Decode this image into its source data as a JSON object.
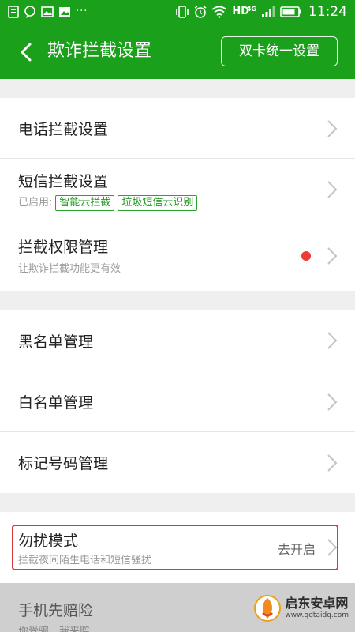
{
  "status_bar": {
    "network": "HD",
    "network_type": "4G",
    "time": "11:24",
    "more": "···"
  },
  "header": {
    "title": "欺诈拦截设置",
    "dual_sim_button": "双卡统一设置"
  },
  "section1": {
    "call_block": {
      "title": "电话拦截设置"
    },
    "sms_block": {
      "title": "短信拦截设置",
      "enabled_prefix": "已启用:",
      "tags": [
        "智能云拦截",
        "垃圾短信云识别"
      ]
    },
    "permission": {
      "title": "拦截权限管理",
      "subtitle": "让欺诈拦截功能更有效"
    }
  },
  "section2": {
    "blacklist": {
      "title": "黑名单管理"
    },
    "whitelist": {
      "title": "白名单管理"
    },
    "marked": {
      "title": "标记号码管理"
    }
  },
  "section3": {
    "dnd": {
      "title": "勿扰模式",
      "subtitle": "拦截夜间陌生电话和短信骚扰",
      "value": "去开启"
    }
  },
  "section4": {
    "compensation": {
      "title": "手机先赔险",
      "subtitle": "你受骗，我来赔"
    }
  },
  "watermark": {
    "name": "启东安卓网",
    "url": "www.qdtaidq.com"
  },
  "colors": {
    "primary_green": "#1ba01b",
    "tag_green": "#1f9a1f",
    "dot_red": "#f03a33",
    "highlight_red": "#d63a3a"
  }
}
